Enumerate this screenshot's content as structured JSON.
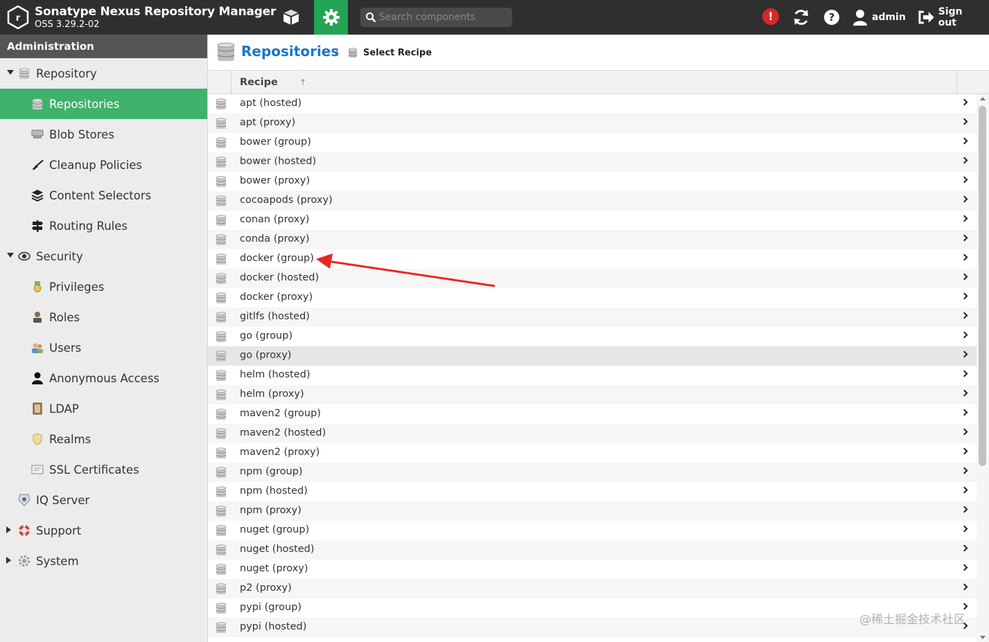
{
  "header": {
    "app_title": "Sonatype Nexus Repository Manager",
    "app_version": "OSS 3.29.2-02",
    "search_placeholder": "Search components",
    "alert_symbol": "!",
    "user_label": "admin",
    "signout_label": "Sign out",
    "icons": [
      "nexus-logo-icon",
      "browse-cube-icon",
      "admin-gear-icon",
      "search-icon",
      "alert-icon",
      "refresh-icon",
      "help-icon",
      "user-icon",
      "sign-out-icon"
    ]
  },
  "sidebar": {
    "title": "Administration",
    "items": [
      {
        "label": "Repository",
        "level": 1,
        "arrow": "down",
        "icon": "database-icon",
        "selected": false
      },
      {
        "label": "Repositories",
        "level": 2,
        "icon": "database-icon",
        "selected": true
      },
      {
        "label": "Blob Stores",
        "level": 2,
        "icon": "blob-store-icon",
        "selected": false
      },
      {
        "label": "Cleanup Policies",
        "level": 2,
        "icon": "broom-icon",
        "selected": false
      },
      {
        "label": "Content Selectors",
        "level": 2,
        "icon": "layers-icon",
        "selected": false
      },
      {
        "label": "Routing Rules",
        "level": 2,
        "icon": "signpost-icon",
        "selected": false
      },
      {
        "label": "Security",
        "level": 1,
        "arrow": "down",
        "icon": "eye-icon",
        "selected": false
      },
      {
        "label": "Privileges",
        "level": 2,
        "icon": "medal-icon",
        "selected": false
      },
      {
        "label": "Roles",
        "level": 2,
        "icon": "role-icon",
        "selected": false
      },
      {
        "label": "Users",
        "level": 2,
        "icon": "users-icon",
        "selected": false
      },
      {
        "label": "Anonymous Access",
        "level": 2,
        "icon": "user-icon",
        "selected": false
      },
      {
        "label": "LDAP",
        "level": 2,
        "icon": "book-icon",
        "selected": false
      },
      {
        "label": "Realms",
        "level": 2,
        "icon": "shield-icon",
        "selected": false
      },
      {
        "label": "SSL Certificates",
        "level": 2,
        "icon": "certificate-icon",
        "selected": false
      },
      {
        "label": "IQ Server",
        "level": 1,
        "arrow": "none",
        "icon": "iq-server-icon",
        "selected": false
      },
      {
        "label": "Support",
        "level": 1,
        "arrow": "right",
        "icon": "lifebuoy-icon",
        "selected": false
      },
      {
        "label": "System",
        "level": 1,
        "arrow": "right",
        "icon": "cog-icon",
        "selected": false
      }
    ]
  },
  "breadcrumb": {
    "title": "Repositories",
    "separator": "/",
    "current": "Select Recipe"
  },
  "grid": {
    "column_header": "Recipe",
    "sort_indicator": "↑",
    "hover_row": "go (proxy)",
    "rows": [
      "apt (hosted)",
      "apt (proxy)",
      "bower (group)",
      "bower (hosted)",
      "bower (proxy)",
      "cocoapods (proxy)",
      "conan (proxy)",
      "conda (proxy)",
      "docker (group)",
      "docker (hosted)",
      "docker (proxy)",
      "gitlfs (hosted)",
      "go (group)",
      "go (proxy)",
      "helm (hosted)",
      "helm (proxy)",
      "maven2 (group)",
      "maven2 (hosted)",
      "maven2 (proxy)",
      "npm (group)",
      "npm (hosted)",
      "npm (proxy)",
      "nuget (group)",
      "nuget (hosted)",
      "nuget (proxy)",
      "p2 (proxy)",
      "pypi (group)",
      "pypi (hosted)"
    ]
  },
  "colors": {
    "topbar": "#2f2f2f",
    "accent_green": "#3fb26b",
    "link_blue": "#1b77c5",
    "alert_red": "#d9262a",
    "annotation_arrow": "#e8281e"
  },
  "watermark": "@稀土掘金技术社区"
}
